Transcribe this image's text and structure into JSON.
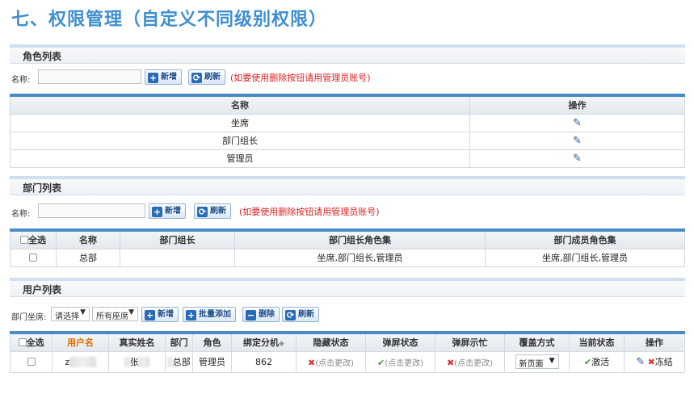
{
  "page_title": "七、权限管理（自定义不同级别权限）",
  "role_section": {
    "title": "角色列表",
    "name_label": "名称:",
    "name_value": "",
    "add_label": "新增",
    "refresh_label": "刷新",
    "note": "(如要使用删除按钮请用管理员账号)",
    "headers": [
      "名称",
      "操作"
    ],
    "rows": [
      "坐席",
      "部门组长",
      "管理员"
    ]
  },
  "dept_section": {
    "title": "部门列表",
    "name_label": "名称:",
    "name_value": "",
    "add_label": "新增",
    "refresh_label": "刷新",
    "note": "(如要使用删除按钮请用管理员账号)",
    "headers": [
      "全选",
      "名称",
      "部门组长",
      "部门组长角色集",
      "部门成员角色集"
    ],
    "rows": [
      {
        "name": "总部",
        "leader": "",
        "leader_roles": "坐席,部门组长,管理员",
        "member_roles": "坐席,部门组长,管理员"
      }
    ]
  },
  "user_section": {
    "title": "用户列表",
    "dept_label": "部门坐席:",
    "dept_select": "请选择",
    "seat_select": "所有座席",
    "add_label": "新增",
    "batch_add_label": "批量添加",
    "delete_label": "删除",
    "refresh_label": "刷新",
    "headers": [
      "全选",
      "用户名",
      "真实姓名",
      "部门",
      "角色",
      "绑定分机",
      "隐藏状态",
      "弹屏状态",
      "弹屏示忙",
      "覆盖方式",
      "当前状态",
      "操作"
    ],
    "rows": [
      {
        "username": "z",
        "realname": "张",
        "dept": "总部",
        "role": "管理员",
        "ext": "862",
        "hide_status": "(点击更改)",
        "popup_status": "(点击更改)",
        "popup_busy": "(点击更改)",
        "cover_mode": "新页面",
        "current_status": "激活",
        "freeze_label": "冻结"
      }
    ]
  },
  "colors": {
    "title_blue": "#3f8fcf",
    "note_red": "#dd2222",
    "header_orange": "#e07000"
  }
}
